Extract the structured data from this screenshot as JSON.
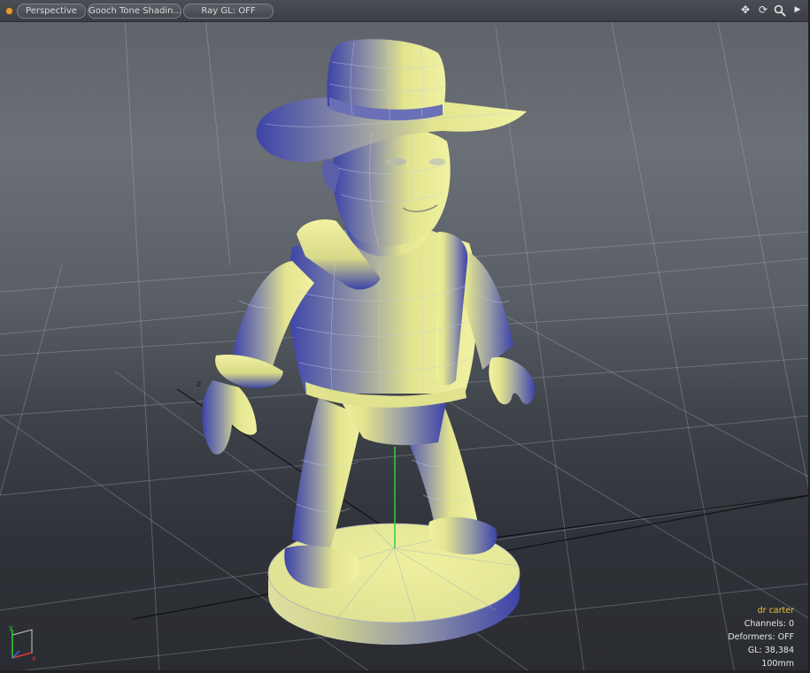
{
  "toolbar": {
    "view_mode": "Perspective",
    "shading_mode": "Gooch Tone Shadin...",
    "ray_gl": "Ray GL: OFF",
    "icons": [
      "pan-icon",
      "rotate-icon",
      "zoom-icon",
      "expand-arrow-icon"
    ]
  },
  "viewport": {
    "model": "cowboy figurine on round base",
    "axis_labels": {
      "z": "z",
      "y": "y",
      "x": "x"
    },
    "colors": {
      "model_light": "#e6e88e",
      "model_shadow": "#3c43a8",
      "grid": "#b8bdc6",
      "y_axis": "#2fd03a"
    }
  },
  "info_overlay": {
    "user": "dr carter",
    "channels": "Channels: 0",
    "deformers": "Deformers: OFF",
    "gl": "GL: 38,384",
    "scale": "100mm"
  }
}
